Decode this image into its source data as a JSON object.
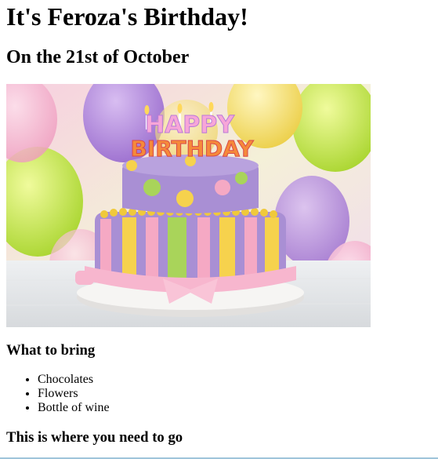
{
  "page": {
    "title": "It's Feroza's Birthday!",
    "subtitle": "On the 21st of October"
  },
  "image": {
    "cake_topper_top": "HAPPY",
    "cake_topper_bottom": "BIRTHDAY",
    "colors": {
      "balloon_purple": "#b48ad8",
      "balloon_green": "#c8e85a",
      "balloon_yellow": "#f4e27a",
      "balloon_pink": "#f3a9c9",
      "cake_top": "#a98fd4",
      "stripe_yellow": "#f6d24d",
      "stripe_green": "#a9d45a",
      "stripe_pink": "#f5a9c4",
      "plate": "#f4f2f1"
    }
  },
  "sections": {
    "bring": {
      "heading": "What to bring",
      "items": [
        "Chocolates",
        "Flowers",
        "Bottle of wine"
      ]
    },
    "directions": {
      "heading": "This is where you need to go"
    }
  }
}
